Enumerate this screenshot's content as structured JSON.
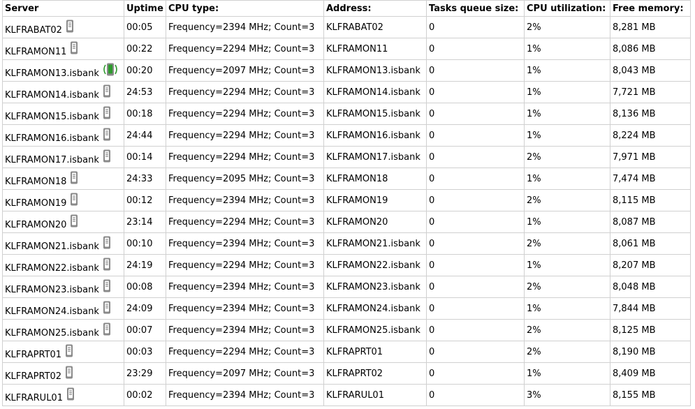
{
  "columns": {
    "server": "Server",
    "uptime": "Uptime",
    "cpu_type": "CPU type:",
    "address": "Address:",
    "tasks_queue": "Tasks queue size:",
    "cpu_util": "CPU utilization:",
    "free_memory": "Free memory:"
  },
  "icons": {
    "idle": "server-icon",
    "active": "server-activity-icon"
  },
  "colors": {
    "grid_border": "#d0d0d0",
    "icon_gray": "#8a8a8a",
    "icon_active_green": "#2e9a2e"
  },
  "rows": [
    {
      "server": "KLFRABAT02",
      "icon": "idle",
      "uptime": "00:05",
      "cpu_type": "Frequency=2394 MHz; Count=3",
      "address": "KLFRABAT02",
      "tasks": "0",
      "cpu": "2%",
      "memory": "8,281 MB"
    },
    {
      "server": "KLFRAMON11",
      "icon": "idle",
      "uptime": "00:22",
      "cpu_type": "Frequency=2294 MHz; Count=3",
      "address": "KLFRAMON11",
      "tasks": "0",
      "cpu": "1%",
      "memory": "8,086 MB"
    },
    {
      "server": "KLFRAMON13.isbank",
      "icon": "active",
      "uptime": "00:20",
      "cpu_type": "Frequency=2097 MHz; Count=3",
      "address": "KLFRAMON13.isbank",
      "tasks": "0",
      "cpu": "1%",
      "memory": "8,043 MB"
    },
    {
      "server": "KLFRAMON14.isbank",
      "icon": "idle",
      "uptime": "24:53",
      "cpu_type": "Frequency=2294 MHz; Count=3",
      "address": "KLFRAMON14.isbank",
      "tasks": "0",
      "cpu": "1%",
      "memory": "7,721 MB"
    },
    {
      "server": "KLFRAMON15.isbank",
      "icon": "idle",
      "uptime": "00:18",
      "cpu_type": "Frequency=2294 MHz; Count=3",
      "address": "KLFRAMON15.isbank",
      "tasks": "0",
      "cpu": "1%",
      "memory": "8,136 MB"
    },
    {
      "server": "KLFRAMON16.isbank",
      "icon": "idle",
      "uptime": "24:44",
      "cpu_type": "Frequency=2294 MHz; Count=3",
      "address": "KLFRAMON16.isbank",
      "tasks": "0",
      "cpu": "1%",
      "memory": "8,224 MB"
    },
    {
      "server": "KLFRAMON17.isbank",
      "icon": "idle",
      "uptime": "00:14",
      "cpu_type": "Frequency=2294 MHz; Count=3",
      "address": "KLFRAMON17.isbank",
      "tasks": "0",
      "cpu": "2%",
      "memory": "7,971 MB"
    },
    {
      "server": "KLFRAMON18",
      "icon": "idle",
      "uptime": "24:33",
      "cpu_type": "Frequency=2095 MHz; Count=3",
      "address": "KLFRAMON18",
      "tasks": "0",
      "cpu": "1%",
      "memory": "7,474 MB"
    },
    {
      "server": "KLFRAMON19",
      "icon": "idle",
      "uptime": "00:12",
      "cpu_type": "Frequency=2394 MHz; Count=3",
      "address": "KLFRAMON19",
      "tasks": "0",
      "cpu": "2%",
      "memory": "8,115 MB"
    },
    {
      "server": "KLFRAMON20",
      "icon": "idle",
      "uptime": "23:14",
      "cpu_type": "Frequency=2294 MHz; Count=3",
      "address": "KLFRAMON20",
      "tasks": "0",
      "cpu": "1%",
      "memory": "8,087 MB"
    },
    {
      "server": "KLFRAMON21.isbank",
      "icon": "idle",
      "uptime": "00:10",
      "cpu_type": "Frequency=2394 MHz; Count=3",
      "address": "KLFRAMON21.isbank",
      "tasks": "0",
      "cpu": "2%",
      "memory": "8,061 MB"
    },
    {
      "server": "KLFRAMON22.isbank",
      "icon": "idle",
      "uptime": "24:19",
      "cpu_type": "Frequency=2294 MHz; Count=3",
      "address": "KLFRAMON22.isbank",
      "tasks": "0",
      "cpu": "1%",
      "memory": "8,207 MB"
    },
    {
      "server": "KLFRAMON23.isbank",
      "icon": "idle",
      "uptime": "00:08",
      "cpu_type": "Frequency=2394 MHz; Count=3",
      "address": "KLFRAMON23.isbank",
      "tasks": "0",
      "cpu": "2%",
      "memory": "8,048 MB"
    },
    {
      "server": "KLFRAMON24.isbank",
      "icon": "idle",
      "uptime": "24:09",
      "cpu_type": "Frequency=2394 MHz; Count=3",
      "address": "KLFRAMON24.isbank",
      "tasks": "0",
      "cpu": "1%",
      "memory": "7,844 MB"
    },
    {
      "server": "KLFRAMON25.isbank",
      "icon": "idle",
      "uptime": "00:07",
      "cpu_type": "Frequency=2394 MHz; Count=3",
      "address": "KLFRAMON25.isbank",
      "tasks": "0",
      "cpu": "2%",
      "memory": "8,125 MB"
    },
    {
      "server": "KLFRAPRT01",
      "icon": "idle",
      "uptime": "00:03",
      "cpu_type": "Frequency=2294 MHz; Count=3",
      "address": "KLFRAPRT01",
      "tasks": "0",
      "cpu": "2%",
      "memory": "8,190 MB"
    },
    {
      "server": "KLFRAPRT02",
      "icon": "idle",
      "uptime": "23:29",
      "cpu_type": "Frequency=2097 MHz; Count=3",
      "address": "KLFRAPRT02",
      "tasks": "0",
      "cpu": "1%",
      "memory": "8,409 MB"
    },
    {
      "server": "KLFRARUL01",
      "icon": "idle",
      "uptime": "00:02",
      "cpu_type": "Frequency=2394 MHz; Count=3",
      "address": "KLFRARUL01",
      "tasks": "0",
      "cpu": "3%",
      "memory": "8,155 MB"
    }
  ]
}
